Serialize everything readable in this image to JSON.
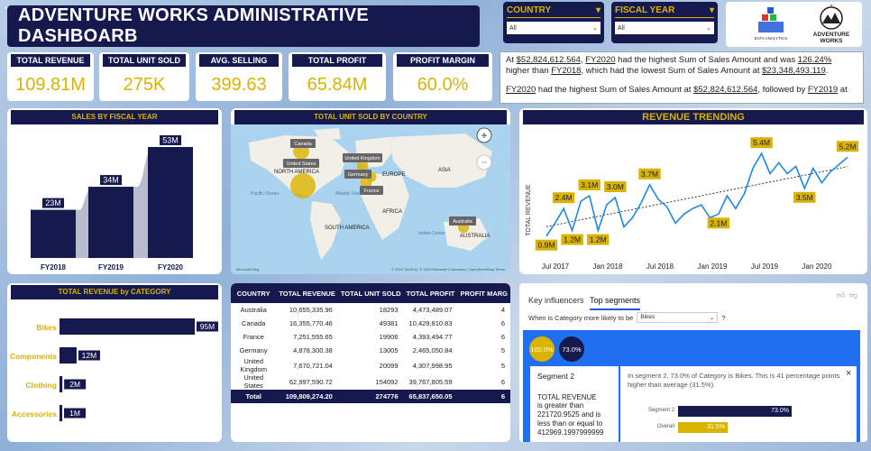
{
  "header": {
    "title": "ADVENTURE WORKS ADMINISTRATIVE  DASHBOARB",
    "country_label": "COUNTRY",
    "country_value": "All",
    "fiscal_label": "FISCAL YEAR",
    "fiscal_value": "All",
    "logo1_text": "DATA ANALYTICS",
    "logo2_line1": "ADVENTURE",
    "logo2_line2": "WORKS"
  },
  "kpis": [
    {
      "label": "TOTAL REVENUE",
      "value": "109.81M"
    },
    {
      "label": "TOTAL UNIT SOLD",
      "value": "275K"
    },
    {
      "label": "AVG. SELLING PRICE",
      "value": "399.63"
    },
    {
      "label": "TOTAL PROFIT",
      "value": "65.84M"
    },
    {
      "label": "PROFIT MARGIN",
      "value": "60.0%"
    }
  ],
  "narrative": {
    "p1_a": "At ",
    "p1_amount": "$52,824,612.564",
    "p1_b": ", ",
    "p1_year": "FY2020",
    "p1_c": " had the highest Sum of Sales Amount and was ",
    "p1_pct": "126.24%",
    "p1_d": " higher than ",
    "p1_year2": "FY2018",
    "p1_e": ", which had the lowest Sum of Sales Amount at ",
    "p1_amount2": "$23,348,493.119",
    "p1_f": ".",
    "p2_year": "FY2020",
    "p2_a": " had the highest Sum of Sales Amount at ",
    "p2_amount": "$52,824,612.564",
    "p2_b": ", followed by ",
    "p2_year2": "FY2019",
    "p2_c": " at"
  },
  "sales_fy": {
    "title": "SALES BY FISCAL YEAR"
  },
  "map": {
    "title": "TOTAL UNIT SOLD BY COUNTRY",
    "labels": {
      "canada": "Canada",
      "us": "United States",
      "uk": "United Kingdom",
      "germany": "Germany",
      "france": "France",
      "australia": "Australia",
      "north_america": "NORTH AMERICA",
      "europe": "EUROPE",
      "asia": "ASIA",
      "africa": "AFRICA",
      "south_america": "SOUTH AMERICA",
      "pacific": "Pacific Ocean",
      "atlantic": "Atlantic Ocean",
      "indian": "Indian Ocean",
      "australia_region": "AUSTRALIA"
    },
    "zoom_in": "+",
    "zoom_out": "−",
    "credit": "© 2024 TomTom, © 2024 Microsoft Corporation, OpenStreetMap  Terms",
    "brand": "Microsoft Bing"
  },
  "revenue_trend": {
    "title": "REVENUE TRENDING",
    "ylabel": "TOTAL REVENUE"
  },
  "category": {
    "title": "TOTAL REVENUE by CATEGORY"
  },
  "table": {
    "columns": [
      "COUNTRY",
      "TOTAL REVENUE",
      "TOTAL UNIT SOLD",
      "TOTAL PROFIT",
      "PROFIT MARG"
    ],
    "rows": [
      [
        "Australia",
        "10,655,335.96",
        "18293",
        "4,473,489.07",
        "4"
      ],
      [
        "Canada",
        "16,355,770.46",
        "49381",
        "10,429,810.83",
        "6"
      ],
      [
        "France",
        "7,251,555.65",
        "19906",
        "4,393,494.77",
        "6"
      ],
      [
        "Germany",
        "4,878,300.38",
        "13005",
        "2,465,050.84",
        "5"
      ],
      [
        "United Kingdom",
        "7,670,721.04",
        "20099",
        "4,307,998.95",
        "5"
      ],
      [
        "United States",
        "62,997,590.72",
        "154092",
        "39,767,805.59",
        "6"
      ]
    ],
    "total": [
      "Total",
      "109,809,274.20",
      "274776",
      "65,837,650.05",
      "6"
    ]
  },
  "influencers": {
    "tab1": "Key influencers",
    "tab2": "Top segments",
    "question": "When is Category more likely to be",
    "question_value": "Bikes",
    "question_mark": "?",
    "bubble1": "100.0%",
    "bubble2": "73.0%",
    "segment_title": "Segment 2",
    "segment_desc1": "TOTAL REVENUE",
    "segment_desc2": "is greater than 221720.9525 and is less than or equal to 412969.1997999999",
    "explain": "In segment 2, 73.0% of Category is Bikes. This is 41 percentage points higher than average (31.5%).",
    "bar1_label": "Segment 2",
    "bar1_value": "73.0%",
    "bar2_label": "Overall",
    "bar2_value": "31.5%",
    "close": "×"
  },
  "colors": {
    "navy": "#15194d",
    "gold": "#d9b300",
    "line": "#1e88e5",
    "grey_area": "#b9bccc"
  },
  "chart_data": [
    {
      "type": "area",
      "categories": [
        "FY2018",
        "FY2019",
        "FY2020"
      ],
      "values": [
        23,
        34,
        53
      ],
      "data_labels": [
        "23M",
        "34M",
        "53M"
      ],
      "title": "SALES BY FISCAL YEAR"
    },
    {
      "type": "line",
      "title": "REVENUE TRENDING",
      "ylabel": "TOTAL REVENUE",
      "x_ticks": [
        "Jul 2017",
        "Jan 2018",
        "Jul 2018",
        "Jan 2019",
        "Jul 2019",
        "Jan 2020"
      ],
      "series": [
        {
          "values": [
            0.9,
            1.6,
            2.4,
            1.2,
            2.8,
            3.1,
            1.2,
            2.6,
            3.0,
            1.4,
            1.9,
            2.7,
            3.7,
            2.9,
            2.5,
            1.6,
            2.1,
            2.4,
            2.6,
            1.9,
            2.1,
            3.1,
            2.4,
            3.2,
            4.6,
            5.4,
            4.3,
            4.9,
            4.3,
            4.7,
            3.5,
            4.6,
            3.8,
            4.4,
            4.8,
            5.2
          ]
        }
      ],
      "data_labels": [
        {
          "index": 0,
          "text": "0.9M"
        },
        {
          "index": 2,
          "text": "2.4M"
        },
        {
          "index": 3,
          "text": "1.2M"
        },
        {
          "index": 5,
          "text": "3.1M"
        },
        {
          "index": 6,
          "text": "1.2M"
        },
        {
          "index": 8,
          "text": "3.0M"
        },
        {
          "index": 12,
          "text": "3.7M"
        },
        {
          "index": 20,
          "text": "2.1M"
        },
        {
          "index": 25,
          "text": "5.4M"
        },
        {
          "index": 30,
          "text": "3.5M"
        },
        {
          "index": 35,
          "text": "5.2M"
        }
      ],
      "trendline": true,
      "ylim": [
        0,
        6
      ]
    },
    {
      "type": "bar",
      "orientation": "horizontal",
      "title": "TOTAL REVENUE by CATEGORY",
      "categories": [
        "Bikes",
        "Components",
        "Clothing",
        "Accessories"
      ],
      "values": [
        95,
        12,
        2,
        1
      ],
      "data_labels": [
        "95M",
        "12M",
        "2M",
        "1M"
      ]
    },
    {
      "type": "scatter",
      "title": "TOTAL UNIT SOLD BY COUNTRY",
      "categories": [
        "Canada",
        "United States",
        "United Kingdom",
        "Germany",
        "France",
        "Australia"
      ],
      "values": [
        49381,
        154092,
        20099,
        13005,
        19906,
        18293
      ]
    }
  ]
}
